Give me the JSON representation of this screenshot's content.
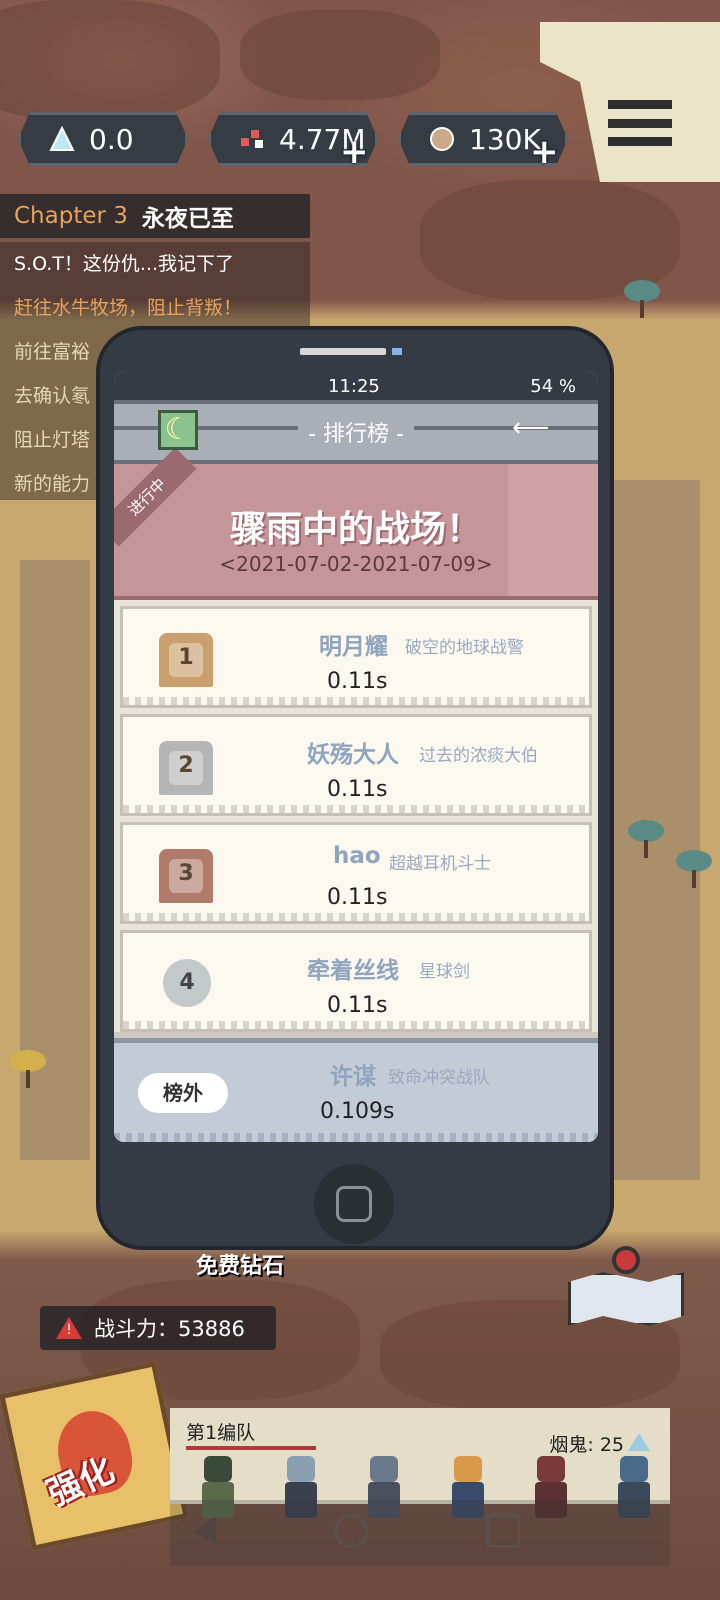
{
  "resources": {
    "crystal": "0.0",
    "parts": "4.77M",
    "ore": "130K"
  },
  "chapter": {
    "number": "Chapter 3",
    "title": "永夜已至"
  },
  "quest_lines": [
    "S.O.T！这份仇...我记下了",
    "赶往水牛牧场，阻止背叛！",
    "前往富裕",
    "去确认氡",
    "阻止灯塔",
    "新的能力"
  ],
  "phone": {
    "time": "11:25",
    "battery": "54 %",
    "title": "- 排行榜 -",
    "event_ribbon": "进行中",
    "event_name": "骤雨中的战场！",
    "event_dates": "<2021-07-02-2021-07-09>",
    "rankings": [
      {
        "rank": "1",
        "name": "明月耀",
        "title": "破空的地球战警",
        "score": "0.11s"
      },
      {
        "rank": "2",
        "name": "妖殇大人",
        "title": "过去的浓痰大伯",
        "score": "0.11s"
      },
      {
        "rank": "3",
        "name": "hao",
        "title": "超越耳机斗士",
        "score": "0.11s"
      },
      {
        "rank": "4",
        "name": "牵着丝线",
        "title": "星球剑",
        "score": "0.11s"
      }
    ],
    "self": {
      "badge": "榜外",
      "name": "许谋",
      "title": "致命冲突战队",
      "score": "0.109s"
    }
  },
  "free_diamonds": "免费钻石",
  "power": {
    "label": "战斗力：53886"
  },
  "boost_label": "强化",
  "team": {
    "name": "第1编队",
    "ghost": "烟鬼: 25"
  },
  "colors": {
    "accent": "#e5a25a",
    "event": "#c69599",
    "phone": "#353b44"
  }
}
